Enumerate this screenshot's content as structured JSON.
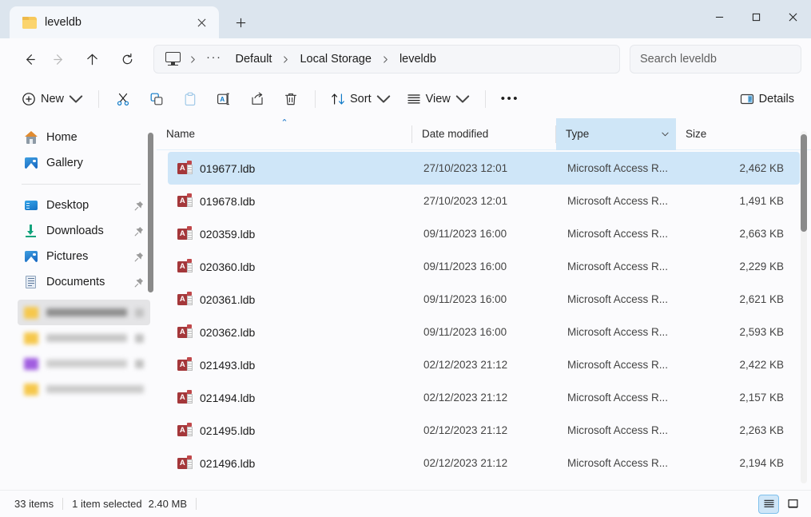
{
  "window": {
    "controls": {
      "minimize": "minimize-icon",
      "maximize": "maximize-icon",
      "close": "close-icon"
    }
  },
  "tabs": {
    "items": [
      {
        "label": "leveldb",
        "icon": "folder-icon",
        "active": true
      }
    ],
    "close_icon": "close-icon",
    "new_tab_icon": "plus-icon"
  },
  "address": {
    "back_icon": "arrow-left-icon",
    "forward_icon": "arrow-right-icon",
    "up_icon": "arrow-up-icon",
    "refresh_icon": "refresh-icon",
    "root_icon": "this-pc-icon",
    "ellipsis": "···",
    "crumbs": [
      "Default",
      "Local Storage",
      "leveldb"
    ]
  },
  "search": {
    "placeholder": "Search leveldb",
    "value": ""
  },
  "toolbar": {
    "new_label": "New",
    "new_icon": "plus-circle-icon",
    "cut_icon": "scissors-icon",
    "copy_icon": "copy-icon",
    "paste_icon": "paste-icon",
    "rename_icon": "rename-icon",
    "share_icon": "share-icon",
    "delete_icon": "trash-icon",
    "sort_label": "Sort",
    "sort_icon": "sort-arrows-icon",
    "view_label": "View",
    "view_icon": "list-lines-icon",
    "more_label": "•••",
    "details_label": "Details",
    "details_icon": "details-pane-icon"
  },
  "sidebar": {
    "items": [
      {
        "label": "Home",
        "icon": "home-icon",
        "pinned": false
      },
      {
        "label": "Gallery",
        "icon": "gallery-icon",
        "pinned": false
      }
    ],
    "pinned_items": [
      {
        "label": "Desktop",
        "icon": "desktop-icon",
        "pinned": true
      },
      {
        "label": "Downloads",
        "icon": "downloads-icon",
        "pinned": true
      },
      {
        "label": "Pictures",
        "icon": "pictures-icon",
        "pinned": true
      },
      {
        "label": "Documents",
        "icon": "documents-icon",
        "pinned": true
      }
    ],
    "redacted_items": [
      {
        "folder_color": "#f6c84c",
        "width": 92,
        "selected": true,
        "pinned": true
      },
      {
        "folder_color": "#f6c84c",
        "width": 62,
        "selected": false,
        "pinned": true
      },
      {
        "folder_color": "#a15ee0",
        "width": 60,
        "selected": false,
        "pinned": true
      },
      {
        "folder_color": "#f6c84c",
        "width": 44,
        "selected": false,
        "pinned": false
      }
    ]
  },
  "columns": {
    "name": "Name",
    "date_modified": "Date modified",
    "type": "Type",
    "size": "Size",
    "sort_column": "Name",
    "sort_direction": "ascending",
    "sort_marker": "⌃",
    "active_column": "Type"
  },
  "files": [
    {
      "name": "019677.ldb",
      "date": "27/10/2023 12:01",
      "type": "Microsoft Access R...",
      "size": "2,462 KB",
      "selected": true
    },
    {
      "name": "019678.ldb",
      "date": "27/10/2023 12:01",
      "type": "Microsoft Access R...",
      "size": "1,491 KB",
      "selected": false
    },
    {
      "name": "020359.ldb",
      "date": "09/11/2023 16:00",
      "type": "Microsoft Access R...",
      "size": "2,663 KB",
      "selected": false
    },
    {
      "name": "020360.ldb",
      "date": "09/11/2023 16:00",
      "type": "Microsoft Access R...",
      "size": "2,229 KB",
      "selected": false
    },
    {
      "name": "020361.ldb",
      "date": "09/11/2023 16:00",
      "type": "Microsoft Access R...",
      "size": "2,621 KB",
      "selected": false
    },
    {
      "name": "020362.ldb",
      "date": "09/11/2023 16:00",
      "type": "Microsoft Access R...",
      "size": "2,593 KB",
      "selected": false
    },
    {
      "name": "021493.ldb",
      "date": "02/12/2023 21:12",
      "type": "Microsoft Access R...",
      "size": "2,422 KB",
      "selected": false
    },
    {
      "name": "021494.ldb",
      "date": "02/12/2023 21:12",
      "type": "Microsoft Access R...",
      "size": "2,157 KB",
      "selected": false
    },
    {
      "name": "021495.ldb",
      "date": "02/12/2023 21:12",
      "type": "Microsoft Access R...",
      "size": "2,263 KB",
      "selected": false
    },
    {
      "name": "021496.ldb",
      "date": "02/12/2023 21:12",
      "type": "Microsoft Access R...",
      "size": "2,194 KB",
      "selected": false
    }
  ],
  "status": {
    "item_count": "33 items",
    "selection": "1 item selected",
    "selection_size": "2.40 MB",
    "details_view_icon": "details-view-icon",
    "icons_view_icon": "large-icons-view-icon",
    "active_view": "details"
  },
  "colors": {
    "accent": "#0078d4",
    "selection": "#cfe6f8",
    "titlebar": "#dce5ee",
    "access_red": "#a4373a"
  }
}
